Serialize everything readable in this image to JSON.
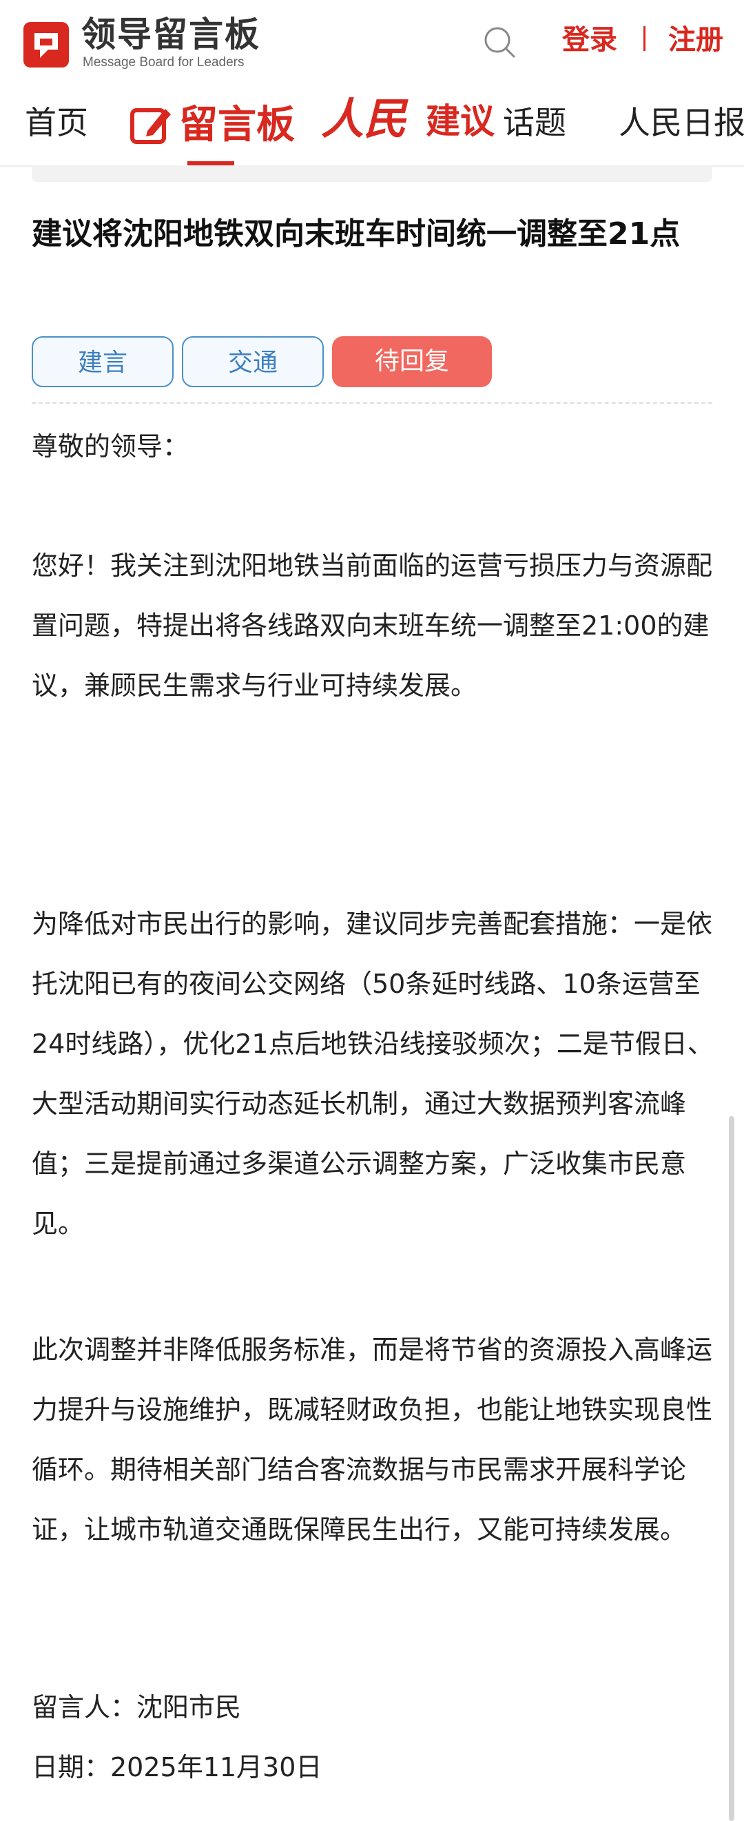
{
  "header": {
    "logo_title": "领导留言板",
    "logo_subtitle": "Message Board for Leaders",
    "login": "登录",
    "register": "注册"
  },
  "nav": {
    "home": "首页",
    "board": "留言板",
    "renmin_script": "人民",
    "renmin_label": "建议",
    "topics": "话题",
    "daily": "人民日报"
  },
  "post": {
    "title": "建议将沈阳地铁双向末班车时间统一调整至21点",
    "tags": [
      "建言",
      "交通"
    ],
    "status": "待回复",
    "greeting": "尊敬的领导：",
    "paragraphs": [
      "您好！我关注到沈阳地铁当前面临的运营亏损压力与资源配置问题，特提出将各线路双向末班车统一调整至21:00的建议，兼顾民生需求与行业可持续发展。",
      "为降低对市民出行的影响，建议同步完善配套措施：一是依托沈阳已有的夜间公交网络（50条延时线路、10条运营至24时线路），优化21点后地铁沿线接驳频次；二是节假日、大型活动期间实行动态延长机制，通过大数据预判客流峰值；三是提前通过多渠道公示调整方案，广泛收集市民意见。",
      "此次调整并非降低服务标准，而是将节省的资源投入高峰运力提升与设施维护，既减轻财政负担，也能让地铁实现良性循环。期待相关部门结合客流数据与市民需求开展科学论证，让城市轨道交通既保障民生出行，又能可持续发展。"
    ],
    "author": "留言人：沈阳市民",
    "date": "日期：2025年11月30日"
  },
  "colors": {
    "brand_red": "#d9281f",
    "tag_blue": "#4a90c8",
    "status_bg": "#f0685f"
  },
  "icons": {
    "logo": "message-board-logo-icon",
    "search": "search-icon",
    "board": "edit-board-icon"
  }
}
